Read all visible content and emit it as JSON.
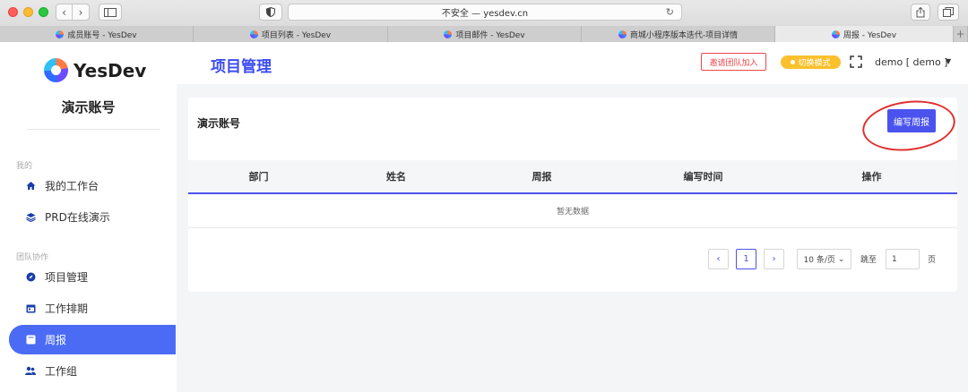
{
  "browser": {
    "url_text": "不安全 — yesdev.cn",
    "tabs": [
      {
        "label": "成员账号 - YesDev",
        "active": false
      },
      {
        "label": "项目列表 - YesDev",
        "active": false
      },
      {
        "label": "项目邮件 - YesDev",
        "active": false
      },
      {
        "label": "商城小程序版本迭代-项目详情",
        "active": false
      },
      {
        "label": "周报 - YesDev",
        "active": true
      }
    ]
  },
  "sidebar": {
    "logo_text": "YesDev",
    "account_name": "演示账号",
    "sections": [
      {
        "label": "我的",
        "items": [
          {
            "label": "我的工作台",
            "icon": "home-icon",
            "active": false
          },
          {
            "label": "PRD在线演示",
            "icon": "layers-icon",
            "active": false
          }
        ]
      },
      {
        "label": "团队协作",
        "items": [
          {
            "label": "项目管理",
            "icon": "compass-icon",
            "active": false
          },
          {
            "label": "工作排期",
            "icon": "calendar-icon",
            "active": false
          },
          {
            "label": "周报",
            "icon": "report-icon",
            "active": true
          },
          {
            "label": "工作组",
            "icon": "team-icon",
            "active": false
          }
        ]
      }
    ]
  },
  "header": {
    "title": "项目管理",
    "invite_label": "邀请团队加入",
    "mode_label": "切换模式",
    "user_label": "demo [ demo ]"
  },
  "card": {
    "title": "演示账号",
    "write_button": "编写周报",
    "columns": [
      "部门",
      "姓名",
      "周报",
      "编写时间",
      "操作"
    ],
    "empty_text": "暂无数据"
  },
  "pagination": {
    "current_page": "1",
    "page_size_label": "10 条/页",
    "jump_label": "跳至",
    "jump_value": "1",
    "page_suffix": "页"
  },
  "colors": {
    "accent": "#4b53ee",
    "title_blue": "#3b4cf0",
    "sidebar_active": "#4b6bf5",
    "warning_yellow": "#fac12d",
    "invite_red": "#f0484a"
  }
}
